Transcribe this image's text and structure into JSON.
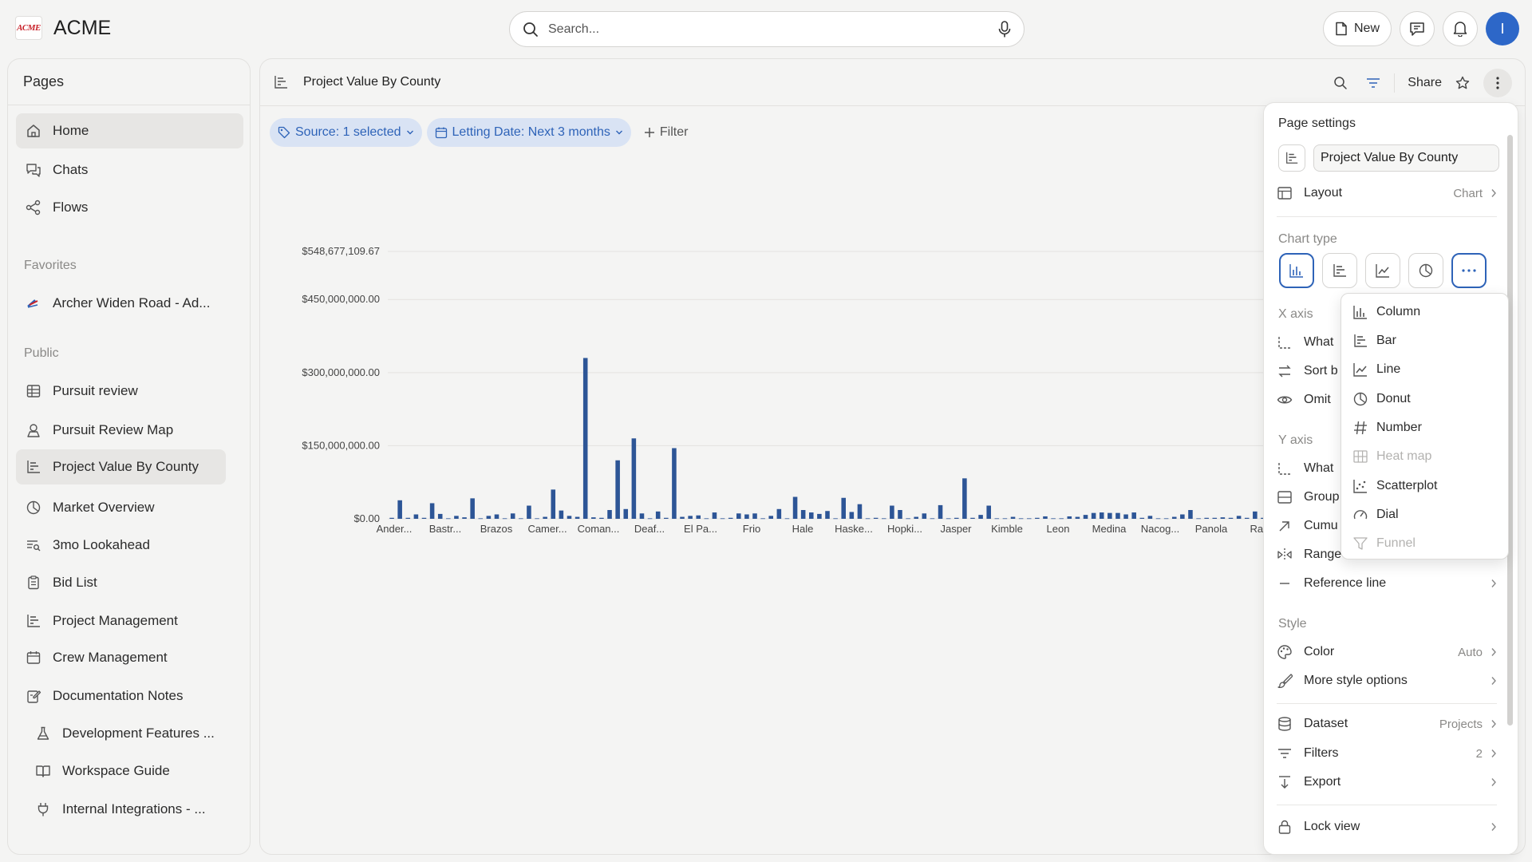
{
  "app": {
    "logo_text": "ACME",
    "name": "ACME"
  },
  "search": {
    "placeholder": "Search..."
  },
  "topbar": {
    "new_label": "New",
    "avatar_initial": "I"
  },
  "sidebar": {
    "title": "Pages",
    "items": [
      {
        "label": "Home"
      },
      {
        "label": "Chats"
      },
      {
        "label": "Flows"
      }
    ],
    "favorites_label": "Favorites",
    "favorites": [
      {
        "label": "Archer Widen Road - Ad..."
      }
    ],
    "public_label": "Public",
    "public": [
      {
        "label": "Pursuit review"
      },
      {
        "label": "Pursuit Review Map"
      },
      {
        "label": "Project Value By County"
      },
      {
        "label": "Market Overview"
      },
      {
        "label": "3mo Lookahead"
      },
      {
        "label": "Bid List"
      },
      {
        "label": "Project Management"
      },
      {
        "label": "Crew Management"
      },
      {
        "label": "Documentation Notes"
      },
      {
        "label": "Development Features ..."
      },
      {
        "label": "Workspace Guide"
      },
      {
        "label": "Internal Integrations - ..."
      }
    ]
  },
  "main": {
    "title": "Project Value By County",
    "share_label": "Share",
    "filters": [
      {
        "label": "Source: 1 selected"
      },
      {
        "label": "Letting Date: Next 3 months"
      }
    ],
    "add_filter_label": "Filter"
  },
  "chart_data": {
    "type": "bar",
    "title": "",
    "xlabel": "",
    "ylabel": "",
    "ylim": [
      0,
      548677109.67
    ],
    "y_ticks": [
      "$548,677,109.67",
      "$450,000,000.00",
      "$300,000,000.00",
      "$150,000,000.00",
      "$0.00"
    ],
    "y_tick_values": [
      548677109.67,
      450000000,
      300000000,
      150000000,
      0
    ],
    "x_tick_labels": [
      "Ander...",
      "Bastr...",
      "Brazos",
      "Camer...",
      "Coman...",
      "Deaf...",
      "El Pa...",
      "Frio",
      "Hale",
      "Haske...",
      "Hopki...",
      "Jasper",
      "Kimble",
      "Leon",
      "Medina",
      "Nacog...",
      "Panola",
      "Rand"
    ],
    "values": [
      2000000,
      38000000,
      2000000,
      9000000,
      2000000,
      32000000,
      10000000,
      1000000,
      6000000,
      3000000,
      42000000,
      1000000,
      6000000,
      9000000,
      1000000,
      11000000,
      1000000,
      27000000,
      1000000,
      4000000,
      60000000,
      17000000,
      6000000,
      4000000,
      330000000,
      3000000,
      2000000,
      18000000,
      120000000,
      20000000,
      165000000,
      11000000,
      1000000,
      15000000,
      2000000,
      145000000,
      4000000,
      6000000,
      7000000,
      1000000,
      13000000,
      1000000,
      2000000,
      11000000,
      9000000,
      11000000,
      1000000,
      6000000,
      20000000,
      1000000,
      45000000,
      18000000,
      13000000,
      10000000,
      16000000,
      1000000,
      43000000,
      14000000,
      30000000,
      1000000,
      2000000,
      1000000,
      27000000,
      18000000,
      1000000,
      4000000,
      11000000,
      1000000,
      28000000,
      1000000,
      2000000,
      83000000,
      2000000,
      8000000,
      27000000,
      1000000,
      1000000,
      4000000,
      1000000,
      1000000,
      2000000,
      5000000,
      1000000,
      1000000,
      5000000,
      4000000,
      8000000,
      12000000,
      13000000,
      12000000,
      12000000,
      9000000,
      13000000,
      2000000,
      6000000,
      1000000,
      1000000,
      4000000,
      9000000,
      18000000,
      1000000,
      2000000,
      2000000,
      3000000,
      2000000,
      6000000,
      2000000,
      15000000,
      2000000
    ],
    "color": "#2d5596",
    "grid": true
  },
  "settings": {
    "title": "Page settings",
    "page_name": "Project Value By County",
    "layout_label": "Layout",
    "layout_value": "Chart",
    "chart_type_label": "Chart type",
    "x_axis_label": "X axis",
    "x_rows": [
      "What",
      "Sort b",
      "Omit"
    ],
    "y_axis_label": "Y axis",
    "y_rows": [
      "What",
      "Group",
      "Cumu",
      "Range",
      "Reference line"
    ],
    "style_label": "Style",
    "color_label": "Color",
    "color_value": "Auto",
    "more_style_label": "More style options",
    "dataset_label": "Dataset",
    "dataset_value": "Projects",
    "filters_label": "Filters",
    "filters_value": "2",
    "export_label": "Export",
    "lock_label": "Lock view"
  },
  "chart_type_menu": {
    "items": [
      {
        "label": "Column",
        "icon": "column-chart-icon",
        "disabled": false
      },
      {
        "label": "Bar",
        "icon": "bar-chart-icon",
        "disabled": false
      },
      {
        "label": "Line",
        "icon": "line-chart-icon",
        "disabled": false
      },
      {
        "label": "Donut",
        "icon": "donut-chart-icon",
        "disabled": false
      },
      {
        "label": "Number",
        "icon": "hash-icon",
        "disabled": false
      },
      {
        "label": "Heat map",
        "icon": "heat-map-icon",
        "disabled": true
      },
      {
        "label": "Scatterplot",
        "icon": "scatterplot-icon",
        "disabled": false
      },
      {
        "label": "Dial",
        "icon": "dial-icon",
        "disabled": false
      },
      {
        "label": "Funnel",
        "icon": "funnel-icon",
        "disabled": true
      }
    ]
  },
  "colors": {
    "accent": "#2e63b8",
    "bar": "#2d5596",
    "chip_bg": "#d9e3f4",
    "avatar": "#2d67c8"
  }
}
